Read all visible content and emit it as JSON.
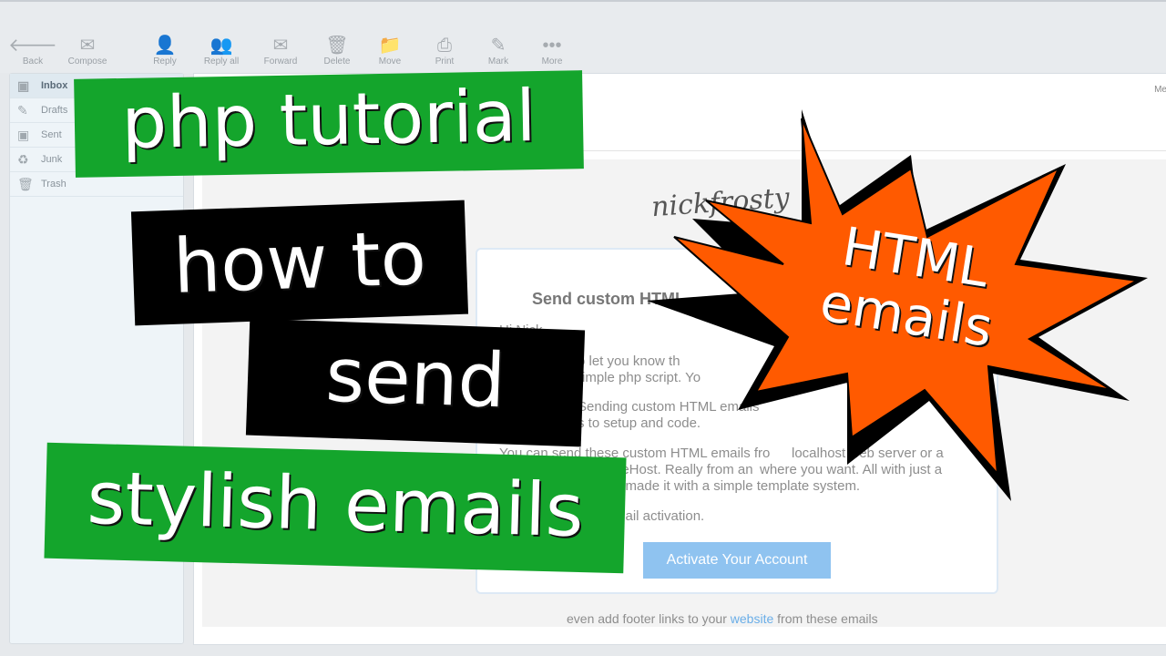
{
  "toolbar": {
    "items": [
      {
        "label": "Back",
        "icon": "arrow-left-icon"
      },
      {
        "label": "Compose",
        "icon": "compose-icon"
      },
      {
        "label": "Reply",
        "icon": "reply-icon"
      },
      {
        "label": "Reply all",
        "icon": "reply-all-icon"
      },
      {
        "label": "Forward",
        "icon": "forward-icon"
      },
      {
        "label": "Delete",
        "icon": "trash-icon"
      },
      {
        "label": "Move",
        "icon": "folder-icon"
      },
      {
        "label": "Print",
        "icon": "printer-icon"
      },
      {
        "label": "Mark",
        "icon": "pen-icon"
      },
      {
        "label": "More",
        "icon": "more-icon"
      }
    ]
  },
  "sidebar": {
    "folders": [
      {
        "label": "Inbox"
      },
      {
        "label": "Drafts"
      },
      {
        "label": "Sent"
      },
      {
        "label": "Junk"
      },
      {
        "label": "Trash"
      }
    ]
  },
  "header": {
    "right_text": "Me"
  },
  "email": {
    "logo": "nickfrosty",
    "title": "Send custom HTML",
    "greeting": "Hi Nick,",
    "l1": "o let you know th",
    "l2": "imple php script. Yo",
    "l3": "Sending custom HTML emails",
    "l4": "s to setup and code.",
    "l5a": "You can send these custom HTML emails fro",
    "l5b": "localhost web server or a",
    "l6a": "ueHost. Really from an",
    "l6b": "where you want. All with just a",
    "l7": "n made it with a simple template system.",
    "l8": "mail activation.",
    "button": "Activate Your Account",
    "footer_pre": "even add footer links to your ",
    "footer_link": "website",
    "footer_post": " from these emails"
  },
  "overlay": {
    "banner1": "php tutorial",
    "banner2": "how to",
    "banner3": "send",
    "banner4": "stylish emails",
    "burst": [
      "HTML",
      "emails"
    ]
  },
  "colors": {
    "green": "#14a52c",
    "orange": "#ff5a00",
    "link": "#6aaee8",
    "button": "#8fc3f0"
  }
}
